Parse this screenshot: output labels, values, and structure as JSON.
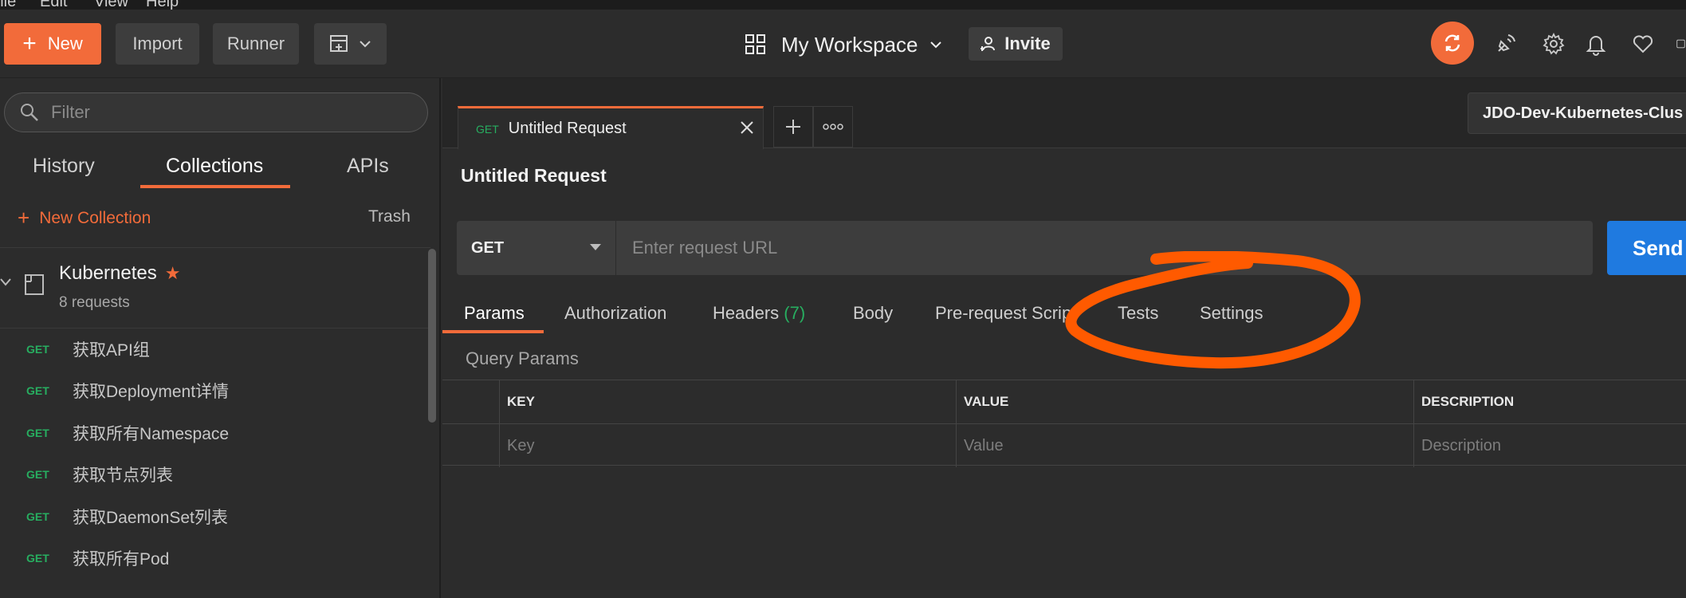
{
  "menubar": [
    "File",
    "Edit",
    "View",
    "Help"
  ],
  "header": {
    "new_label": "New",
    "import_label": "Import",
    "runner_label": "Runner",
    "workspace_label": "My Workspace",
    "invite_label": "Invite"
  },
  "sidebar": {
    "filter_placeholder": "Filter",
    "tabs": [
      "History",
      "Collections",
      "APIs"
    ],
    "active_tab": "Collections",
    "new_collection_label": "New Collection",
    "trash_label": "Trash",
    "collection": {
      "name": "Kubernetes",
      "count": "8 requests",
      "requests": [
        {
          "method": "GET",
          "name": "获取API组"
        },
        {
          "method": "GET",
          "name": "获取Deployment详情"
        },
        {
          "method": "GET",
          "name": "获取所有Namespace"
        },
        {
          "method": "GET",
          "name": "获取节点列表"
        },
        {
          "method": "GET",
          "name": "获取DaemonSet列表"
        },
        {
          "method": "GET",
          "name": "获取所有Pod"
        }
      ]
    }
  },
  "main": {
    "tab": {
      "method": "GET",
      "title": "Untitled Request"
    },
    "environment": "JDO-Dev-Kubernetes-Clus",
    "request_title": "Untitled Request",
    "method": "GET",
    "url_placeholder": "Enter request URL",
    "send_label": "Send",
    "request_tabs": [
      {
        "label": "Params"
      },
      {
        "label": "Authorization"
      },
      {
        "label": "Headers",
        "count": "(7)"
      },
      {
        "label": "Body"
      },
      {
        "label": "Pre-request Script"
      },
      {
        "label": "Tests"
      },
      {
        "label": "Settings"
      }
    ],
    "query_params_label": "Query Params",
    "table": {
      "headers": [
        "KEY",
        "VALUE",
        "DESCRIPTION"
      ],
      "placeholders": [
        "Key",
        "Value",
        "Description"
      ]
    }
  },
  "colors": {
    "accent": "#f26b3a",
    "send": "#1f7ae0",
    "get_method": "#27ae60",
    "annotation": "#ff5a00"
  }
}
